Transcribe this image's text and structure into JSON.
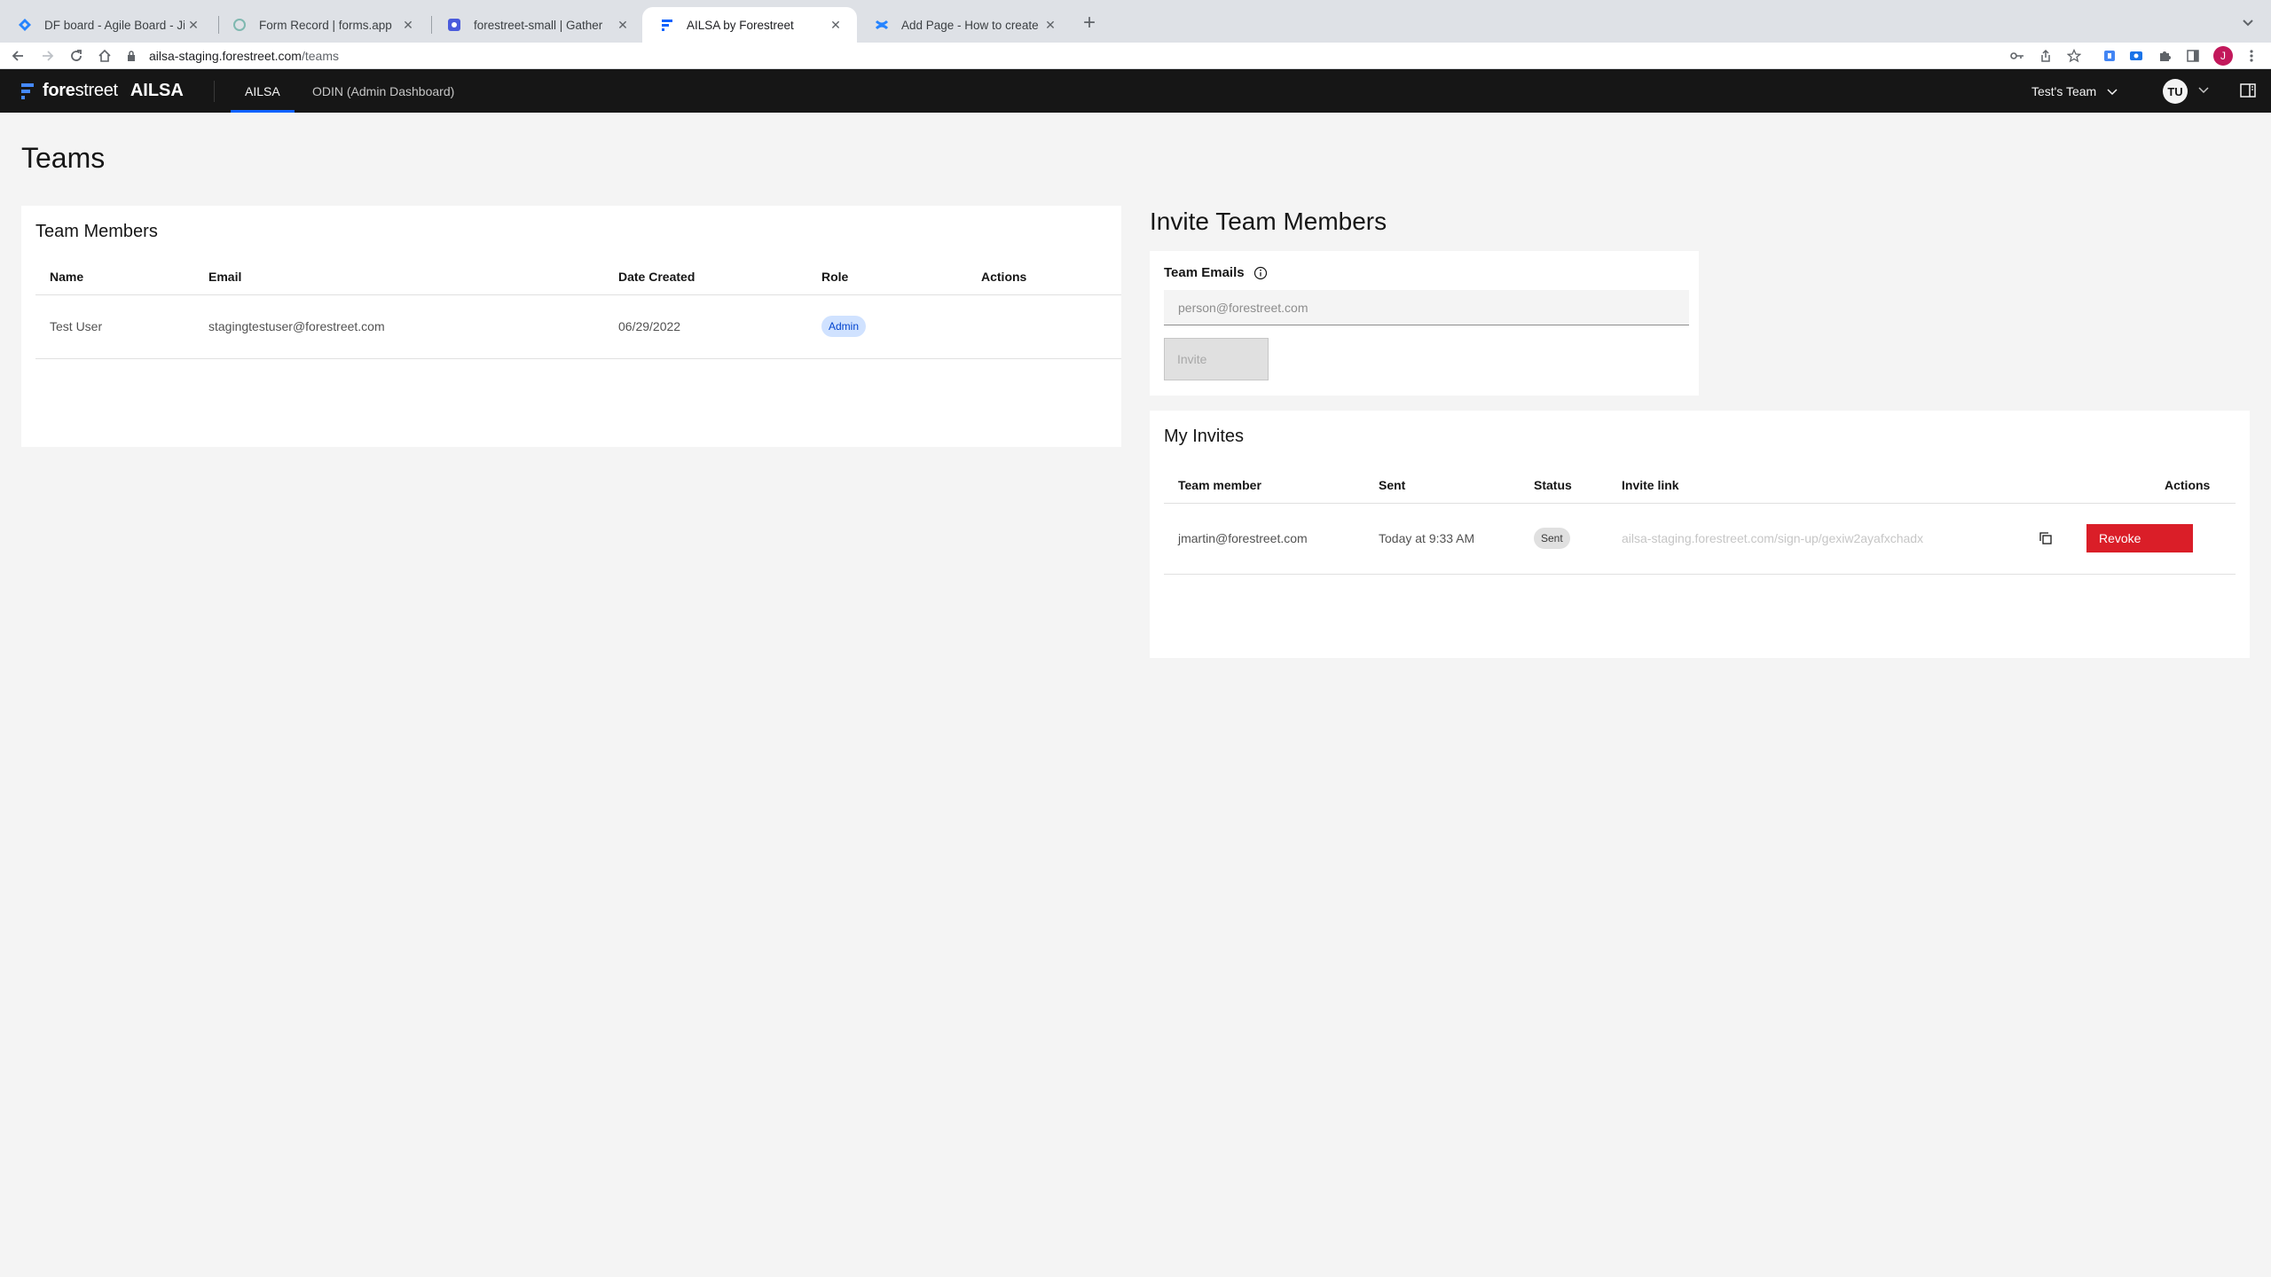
{
  "browser": {
    "tabs": [
      {
        "title": "DF board - Agile Board - Jira",
        "icon": "jira-icon",
        "active": false
      },
      {
        "title": "Form Record | forms.app",
        "icon": "forms-app-icon",
        "active": false
      },
      {
        "title": "forestreet-small | Gather",
        "icon": "gather-icon",
        "active": false
      },
      {
        "title": "AILSA by Forestreet",
        "icon": "forestreet-icon",
        "active": true
      },
      {
        "title": "Add Page - How to create user",
        "icon": "confluence-icon",
        "active": false
      }
    ],
    "url_host": "ailsa-staging.forestreet.com",
    "url_path": "/teams",
    "profile_initial": "J"
  },
  "header": {
    "brand_left": "fore",
    "brand_right": "street",
    "product": "AILSA",
    "nav": [
      {
        "label": "AILSA",
        "active": true
      },
      {
        "label": "ODIN (Admin Dashboard)",
        "active": false
      }
    ],
    "team_selector": "Test's Team",
    "user_initials": "TU"
  },
  "page": {
    "title": "Teams"
  },
  "members": {
    "title": "Team Members",
    "columns": [
      "Name",
      "Email",
      "Date Created",
      "Role",
      "Actions"
    ],
    "rows": [
      {
        "name": "Test User",
        "email": "stagingtestuser@forestreet.com",
        "date_created": "06/29/2022",
        "role": "Admin"
      }
    ]
  },
  "invite": {
    "heading": "Invite Team Members",
    "emails_label": "Team Emails",
    "emails_placeholder": "person@forestreet.com",
    "invite_button": "Invite"
  },
  "my_invites": {
    "title": "My Invites",
    "columns": [
      "Team member",
      "Sent",
      "Status",
      "Invite link",
      "Actions"
    ],
    "rows": [
      {
        "member": "jmartin@forestreet.com",
        "sent": "Today at 9:33 AM",
        "status": "Sent",
        "link": "ailsa-staging.forestreet.com/sign-up/gexiw2ayafxchadx",
        "action": "Revoke"
      }
    ]
  },
  "colors": {
    "header_bg": "#161616",
    "accent": "#0f62fe",
    "danger": "#da1e28",
    "page_bg": "#f4f4f4"
  }
}
